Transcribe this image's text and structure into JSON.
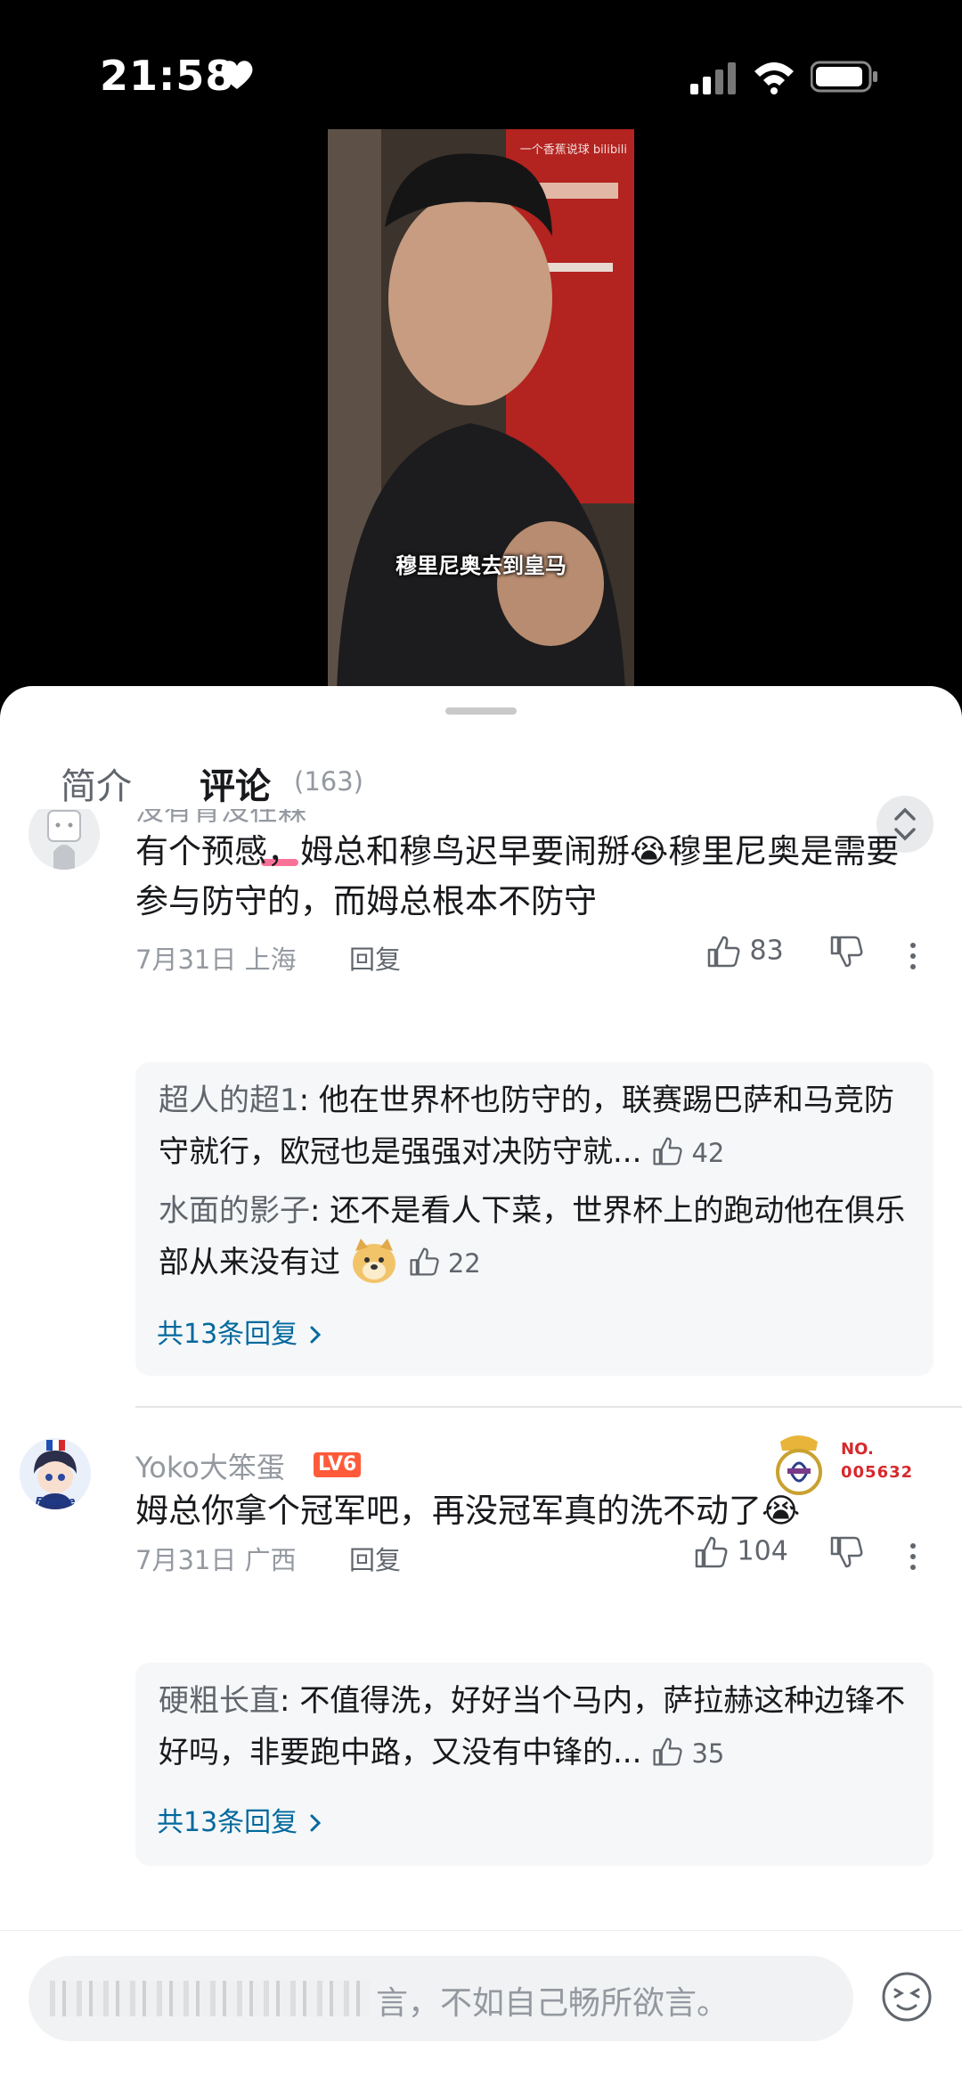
{
  "status": {
    "time": "21:58"
  },
  "video": {
    "watermark": "一个香蕉说球 bilibili",
    "subtitle": "穆里尼奥去到皇马"
  },
  "tabs": {
    "intro": "简介",
    "comments": "评论",
    "count": "(163)"
  },
  "comments": [
    {
      "username": "没有青没在森",
      "text": "有个预感，姆总和穆鸟迟早要闹掰😭穆里尼奥是需要参与防守的，而姆总根本不防守",
      "date": "7月31日 上海",
      "reply_label": "回复",
      "likes": "83",
      "replies": [
        {
          "name": "超人的超1",
          "text": ": 他在世界杯也防守的，联赛踢巴萨和马竞防守就行，欧冠也是强强对决防守就...",
          "likes": "42"
        },
        {
          "name": "水面的影子",
          "text": ": 还不是看人下菜，世界杯上的跑动他在俱乐部从来没有过",
          "likes": "22"
        }
      ],
      "more_replies": "共13条回复"
    },
    {
      "username": "Yoko大笨蛋",
      "level": "LV6",
      "badge_title": "NO.",
      "badge_number": "005632",
      "avatar_caption": "France",
      "text": "姆总你拿个冠军吧，再没冠军真的洗不动了😭",
      "date": "7月31日 广西",
      "reply_label": "回复",
      "likes": "104",
      "replies": [
        {
          "name": "硬粗长直",
          "text": ": 不值得洗，好好当个马内，萨拉赫这种边锋不好吗，非要跑中路，又没有中锋的...",
          "likes": "35"
        }
      ],
      "more_replies": "共13条回复"
    }
  ],
  "input": {
    "placeholder": "言，不如自己畅所欲言。"
  },
  "colors": {
    "accent": "#fb7299",
    "link": "#00699d",
    "level": "#ff5b3a"
  }
}
